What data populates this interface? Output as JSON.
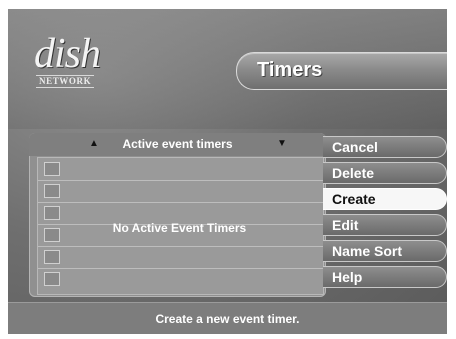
{
  "logo": {
    "main": "dish",
    "sub": "NETWORK"
  },
  "title": "Timers",
  "list": {
    "header": "Active event timers",
    "empty_message": "No Active Event Timers",
    "row_count": 6
  },
  "menu": {
    "items": [
      {
        "label": "Cancel",
        "active": false
      },
      {
        "label": "Delete",
        "active": false
      },
      {
        "label": "Create",
        "active": true
      },
      {
        "label": "Edit",
        "active": false
      },
      {
        "label": "Name Sort",
        "active": false
      },
      {
        "label": "Help",
        "active": false
      }
    ]
  },
  "status": "Create a new event timer.",
  "icons": {
    "up": "triangle-up-icon",
    "down": "triangle-down-icon"
  }
}
